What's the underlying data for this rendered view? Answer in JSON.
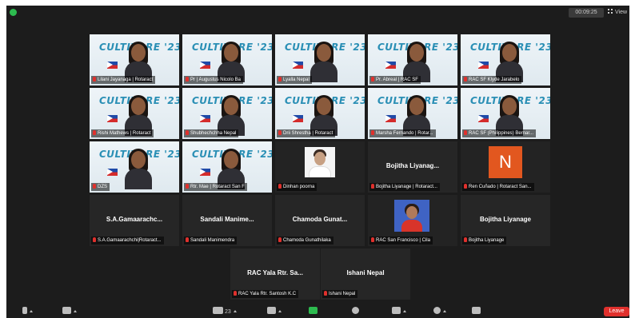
{
  "topbar": {
    "timer": "00:09:25",
    "view_label": "View"
  },
  "banner_title": "CULTIVARE '23",
  "rows": [
    [
      {
        "id": "t1",
        "type": "video",
        "name": "Lilani Jayanaga | Rotaract",
        "active": true
      },
      {
        "id": "t2",
        "type": "video",
        "name": "Pr | Augustus Nicolo Ba",
        "active": false
      },
      {
        "id": "t3",
        "type": "video",
        "name": "Lyalla Nepal",
        "active": false
      },
      {
        "id": "t4",
        "type": "video",
        "name": "Pr. Abreal | RAC SF",
        "active": false
      },
      {
        "id": "t5",
        "type": "video",
        "name": "RAC SF Klyde Jarabelo",
        "active": false
      }
    ],
    [
      {
        "id": "t6",
        "type": "video",
        "name": "Rishi Mathews | Rotaract",
        "active": false
      },
      {
        "id": "t7",
        "type": "video",
        "name": "Shubhechchha Nepal",
        "active": false
      },
      {
        "id": "t8",
        "type": "video",
        "name": "Drii Shrestha | Rotaract",
        "active": false
      },
      {
        "id": "t9",
        "type": "video",
        "name": "Marsha Fernando | Rotar...",
        "active": false
      },
      {
        "id": "t10",
        "type": "video",
        "name": "RAC SF (Philippines) Bernar...",
        "active": false
      }
    ],
    [
      {
        "id": "t11",
        "type": "video",
        "name": "DZS",
        "active": false
      },
      {
        "id": "t12",
        "type": "video",
        "name": "Rtr. Mae | Rotaract San F",
        "active": false
      },
      {
        "id": "t13",
        "type": "avatar-photo",
        "name": "Dinhan poorna",
        "active": false
      },
      {
        "id": "t14",
        "type": "off",
        "display": "Bojitha Liyanag...",
        "name": "Bojitha Liyanage | Rotaract...",
        "active": false
      },
      {
        "id": "t15",
        "type": "letter",
        "letter": "N",
        "name": "Ren Cuñado | Rotaract San...",
        "active": false
      }
    ],
    [
      {
        "id": "t16",
        "type": "off",
        "display": "S.A.Gamaarachc...",
        "name": "S.A.Gamaarachchi|Rotaract...",
        "active": false
      },
      {
        "id": "t17",
        "type": "off",
        "display": "Sandali Manime...",
        "name": "Sandali Manimendra",
        "active": false
      },
      {
        "id": "t18",
        "type": "off",
        "display": "Chamoda Gunat...",
        "name": "Chamoda Gunathilaka",
        "active": false
      },
      {
        "id": "t19",
        "type": "avatar-photo2",
        "name": "RAC San Francisco | Cila",
        "active": false
      },
      {
        "id": "t20",
        "type": "off",
        "display": "Bojitha Liyanage",
        "name": "Bojitha Liyanage",
        "active": false
      }
    ],
    [
      {
        "id": "t21",
        "type": "off",
        "display": "RAC Yala Rtr. Sa...",
        "name": "RAC Yala Rtr. Santosh K.C",
        "active": false
      },
      {
        "id": "t22",
        "type": "off",
        "display": "Ishani Nepal",
        "name": "Ishani Nepal",
        "active": false
      }
    ]
  ],
  "toolbar": {
    "participants_count": "23",
    "leave_label": "Leave"
  },
  "colors": {
    "accent_green": "#2dbb4f",
    "leave_red": "#e0302c",
    "active_border": "#9acd32",
    "banner_text": "#2a8fb5"
  }
}
